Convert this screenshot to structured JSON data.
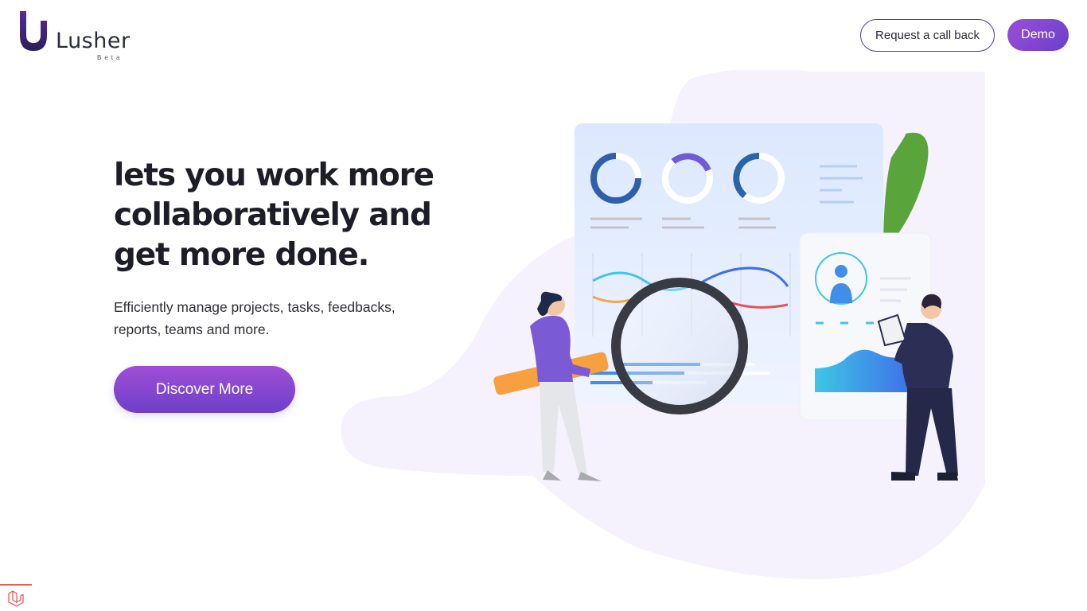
{
  "brand": {
    "name": "Lusher",
    "tag": "Beta"
  },
  "header": {
    "callback_label": "Request a call back",
    "demo_label": "Demo"
  },
  "hero": {
    "headline_line1": "lets you work more",
    "headline_line2": "collaboratively and",
    "headline_line3": "get more done.",
    "subtext_line1": "Efficiently manage projects, tasks, feedbacks,",
    "subtext_line2": "reports, teams and more.",
    "cta_label": "Discover More"
  },
  "colors": {
    "accent": "#8a48d4",
    "accent_dark": "#4b3fa0",
    "blob": "#f5f2fd"
  },
  "icons": {
    "corner": "laravel-icon"
  }
}
